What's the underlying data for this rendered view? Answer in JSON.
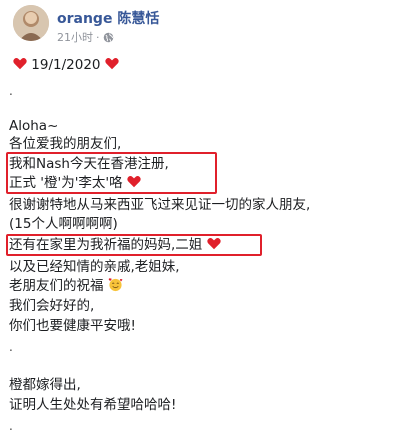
{
  "author": {
    "name": "orange 陈慧恬",
    "timestamp": "21小时",
    "separator": "·",
    "privacy_icon": "globe-icon"
  },
  "post": {
    "date_line": "19/1/2020",
    "heart_icon": "red-heart-emoji",
    "dot": ".",
    "greeting": "Aloha~",
    "lines": [
      "各位爱我的朋友们,",
      "我和Nash今天在香港注册,",
      "正式 '橙'为'李太'咯",
      "很谢谢特地从马来西亚飞过来见证一切的家人朋友,",
      "(15个人啊啊啊啊)",
      "还有在家里为我祈福的妈妈,二姐",
      "以及已经知情的亲戚,老姐妹,",
      "老朋友们的祝福",
      "我们会好好的,",
      "你们也要健康平安哦!",
      "橙都嫁得出,",
      "证明人生处处有希望哈哈哈!"
    ],
    "smiling_face_icon": "smiling-face-with-hearts-emoji"
  },
  "colors": {
    "author_name": "#385898",
    "highlight_box": "#e0202b",
    "heart": "#e0202b",
    "meta_text": "#90949c"
  }
}
